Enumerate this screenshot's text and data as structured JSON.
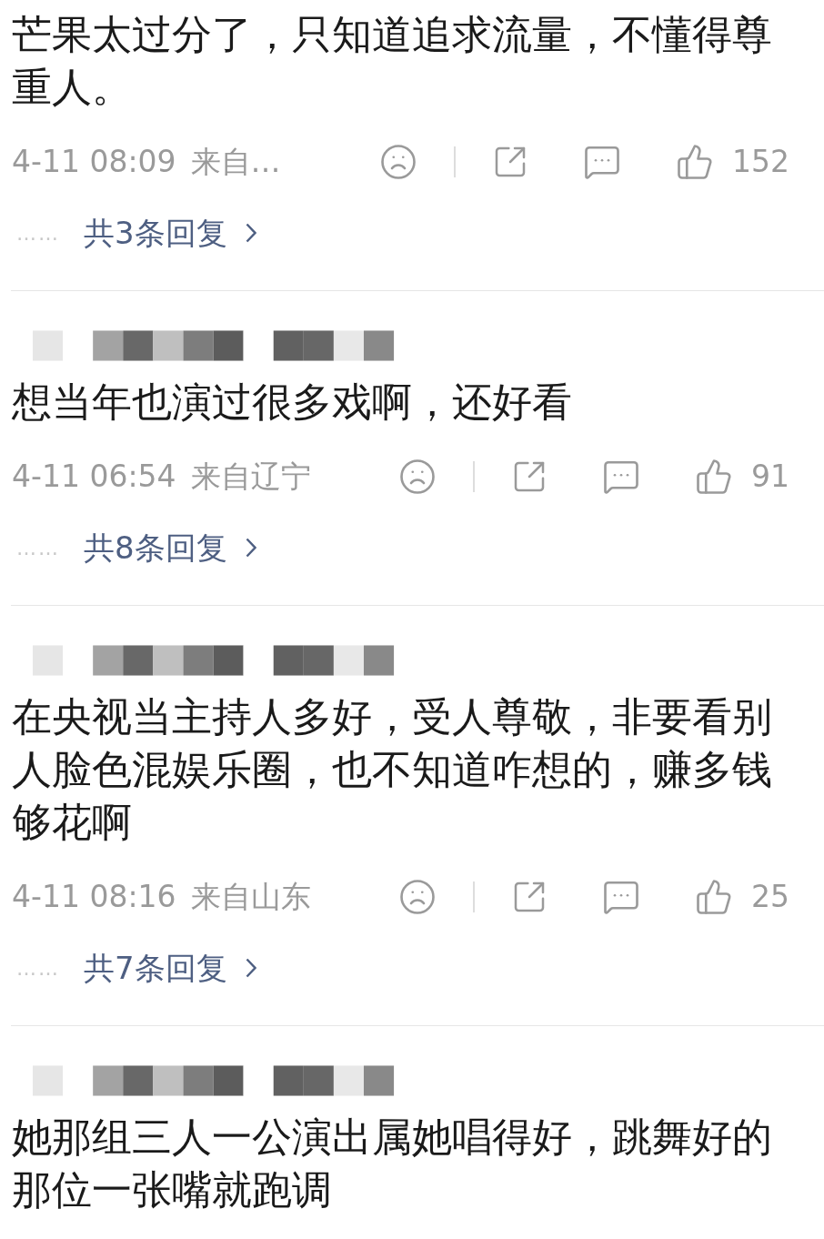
{
  "comments": [
    {
      "name_hidden": false,
      "text": "芒果太过分了，只知道追求流量，不懂得尊重人。",
      "time": "4-11 08:09",
      "location": "来自…",
      "likes": "152",
      "replies": {
        "dots": "……",
        "label": "共3条回复"
      }
    },
    {
      "name_hidden": true,
      "text": "想当年也演过很多戏啊，还好看",
      "time": "4-11 06:54",
      "location": "来自辽宁",
      "likes": "91",
      "replies": {
        "dots": "……",
        "label": "共8条回复"
      }
    },
    {
      "name_hidden": true,
      "text": "在央视当主持人多好，受人尊敬，非要看别人脸色混娱乐圈，也不知道咋想的，赚多钱够花啊",
      "time": "4-11 08:16",
      "location": "来自山东",
      "likes": "25",
      "replies": {
        "dots": "……",
        "label": "共7条回复"
      }
    },
    {
      "name_hidden": true,
      "text": "她那组三人一公演出属她唱得好，跳舞好的那位一张嘴就跑调"
    }
  ]
}
